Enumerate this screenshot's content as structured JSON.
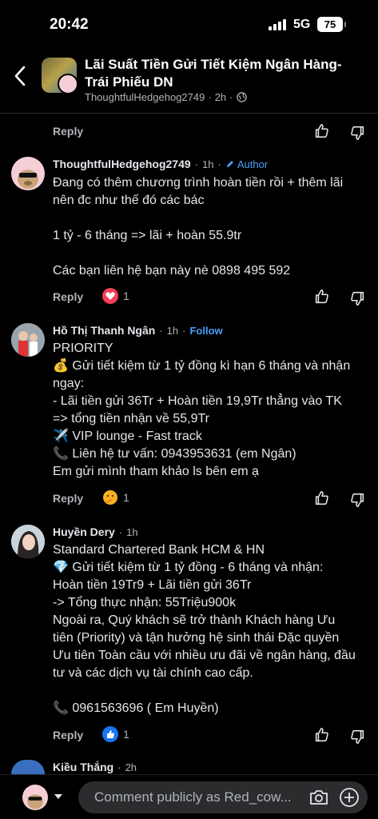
{
  "status": {
    "time": "20:42",
    "network": "5G",
    "battery": "75"
  },
  "header": {
    "title_line1": "Lãi Suất Tiền Gửi Tiết Kiệm Ngân Hàng-",
    "title_line2": "Trái Phiếu DN",
    "author": "ThoughtfulHedgehog2749",
    "time": "2h",
    "visibility_icon": "globe-icon"
  },
  "common": {
    "reply_label": "Reply"
  },
  "comments": [
    {
      "name": "ThoughtfulHedgehog2749",
      "time": "1h",
      "badge": "Author",
      "lines": [
        "Đang có thêm chương trình hoàn tiền rồi + thêm lãi",
        "nên đc như thế đó các bác",
        "",
        "1 tỷ - 6 tháng => lãi + hoàn 55.9tr",
        "",
        "Các bạn liên hệ bạn này nè 0898 495 592"
      ],
      "reaction_icon": "heart-icon",
      "reaction_count": "1"
    },
    {
      "name": "Hồ Thị Thanh Ngân",
      "time": "1h",
      "follow": "Follow",
      "lines": [
        "PRIORITY",
        "💰 Gửi tiết kiệm từ 1 tỷ đồng kì hạn 6 tháng và nhận",
        "ngay:",
        " - Lãi tiền gửi  36Tr + Hoàn tiền 19,9Tr thẳng vào TK",
        "=> tổng tiền nhận về 55,9Tr",
        "✈️ VIP lounge - Fast track",
        "📞 Liên hệ tư vấn: 0943953631 (em Ngân)",
        "Em gửi mình tham khảo ls bên em ạ"
      ],
      "reaction_icon": "care-icon",
      "reaction_count": "1"
    },
    {
      "name": "Huyền Dery",
      "time": "1h",
      "lines": [
        "Standard Chartered Bank HCM & HN",
        "💎 Gửi tiết kiệm từ 1 tỷ đồng - 6 tháng và nhận:",
        "Hoàn tiền 19Tr9 + Lãi tiền gửi 36Tr",
        "-> Tổng thực nhận: 55Triệu900k",
        "Ngoài ra, Quý khách sẽ trở thành Khách hàng Ưu",
        "tiên (Priority) và tận hưởng hệ sinh thái Đặc quyền",
        "Ưu tiên Toàn cầu với nhiều ưu đãi về ngân hàng, đầu",
        "tư và các dịch vụ tài chính cao cấp.",
        "",
        "📞 0961563696 ( Em Huyền)"
      ],
      "reaction_icon": "like-icon",
      "reaction_count": "1"
    },
    {
      "name": "Kiều Thắng",
      "time": "2h"
    }
  ],
  "composer": {
    "placeholder": "Comment publicly as Red_cow..."
  },
  "colors": {
    "link": "#4a9eff",
    "heart": "#f33e58",
    "like": "#1877f2",
    "background": "#000000"
  }
}
